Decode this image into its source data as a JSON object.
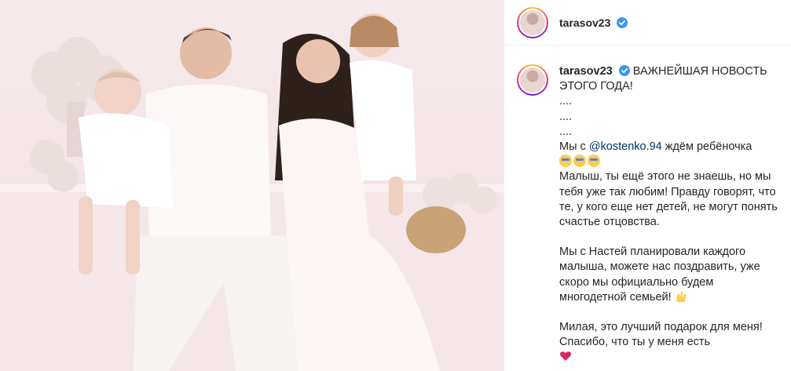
{
  "post": {
    "username": "tarasov23",
    "caption": {
      "headline": "ВАЖНЕЙШАЯ НОВОСТЬ ЭТОГО ГОДА!",
      "dots": [
        "....",
        "....",
        "...."
      ],
      "line_pre": "Мы с",
      "mention": "@kostenko.94",
      "line_post": "ждём ребёночка",
      "p1": "Малыш, ты ещё этого не знаешь, но мы тебя уже так любим! Правду говорят, что те, у кого еще нет детей, не могут понять счастье отцовства.",
      "p2": "Мы с Настей планировали каждого малыша, можете нас поздравить, уже скоро мы официально будем многодетной семьей!",
      "p3": "Милая, это лучший подарок для меня! Спасибо, что ты у меня есть"
    }
  },
  "icons": {
    "verified": "verified-badge-icon",
    "emoji_sleepy": "sleepy-face-emoji",
    "emoji_raised_hands": "raised-hands-emoji",
    "emoji_heart": "red-heart-emoji"
  },
  "colors": {
    "verified": "#3897f0",
    "mention": "#00376b",
    "heart": "#e0245e"
  }
}
